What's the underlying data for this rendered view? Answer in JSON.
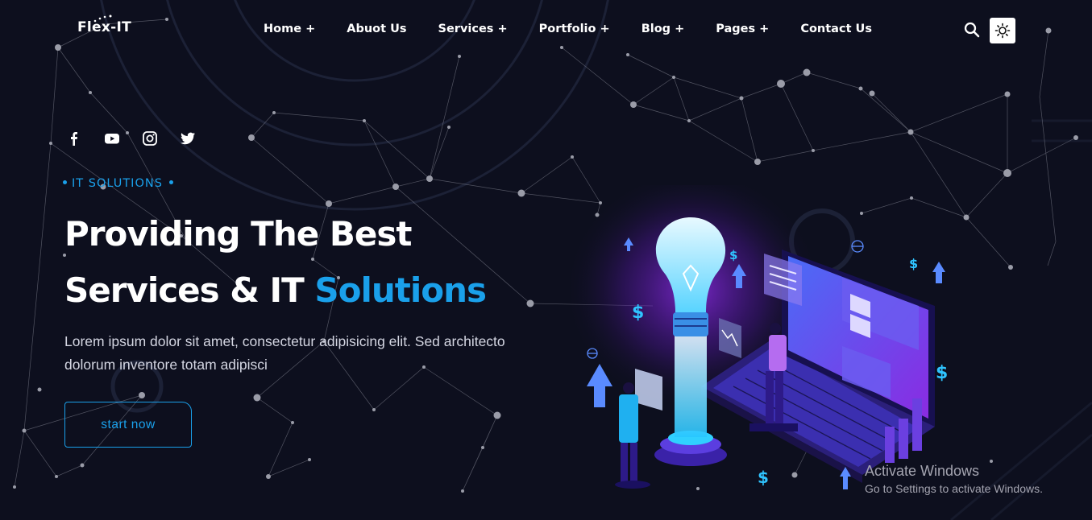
{
  "brand": {
    "logo_text": "Flex-IT"
  },
  "nav": {
    "items": [
      {
        "label": "Home +"
      },
      {
        "label": "Abuot Us"
      },
      {
        "label": "Services +"
      },
      {
        "label": "Portfolio +"
      },
      {
        "label": "Blog +"
      },
      {
        "label": "Pages +"
      },
      {
        "label": "Contact Us"
      }
    ]
  },
  "header_icons": [
    "search-icon",
    "sun-icon"
  ],
  "socials": [
    "facebook-icon",
    "youtube-icon",
    "instagram-icon",
    "twitter-icon"
  ],
  "hero": {
    "kicker": "IT SOLUTIONS",
    "title_line1": "Providing The Best",
    "title_line2_prefix": "Services & IT ",
    "title_line2_accent": "Solutions",
    "description": "Lorem ipsum dolor sit amet, consectetur adipisicing elit. Sed architecto dolorum inventore totam adipisci",
    "cta_label": "start now"
  },
  "watermark": {
    "title": "Activate Windows",
    "subtitle": "Go to Settings to activate Windows."
  },
  "colors": {
    "background": "#0d0f1e",
    "accent": "#1aa0ea",
    "text": "#ffffff",
    "network": "#8a8c99"
  }
}
